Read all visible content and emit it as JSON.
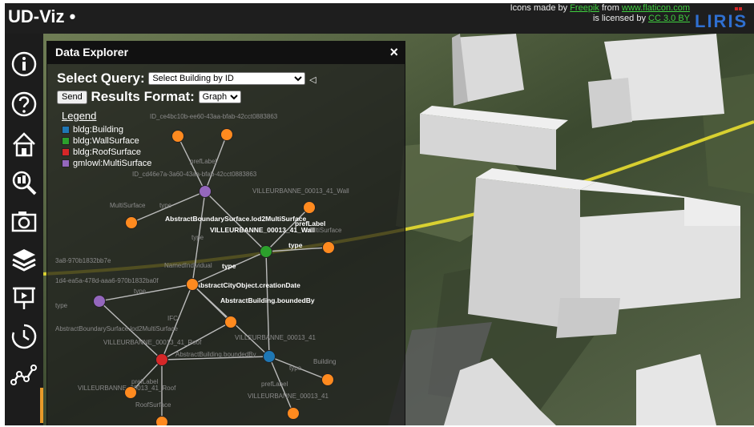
{
  "app": {
    "title": "UD-Viz •"
  },
  "credits": {
    "line1_prefix": "Icons made by ",
    "line1_author": "Freepik",
    "line1_mid": " from ",
    "line1_site": "www.flaticon.com",
    "line2_prefix": "is licensed by ",
    "line2_license": "CC 3.0 BY",
    "logo_text": "LIRIS"
  },
  "sidebar": {
    "items": [
      {
        "name": "about-icon",
        "symbol": "i"
      },
      {
        "name": "help-icon",
        "symbol": "?"
      },
      {
        "name": "home-icon"
      },
      {
        "name": "city-search-icon"
      },
      {
        "name": "camera-icon"
      },
      {
        "name": "layers-icon"
      },
      {
        "name": "presentation-icon"
      },
      {
        "name": "time-icon"
      },
      {
        "name": "graph-icon"
      }
    ]
  },
  "explorer": {
    "title": "Data Explorer",
    "close": "×",
    "query_label": "Select Query:",
    "query_value": "Select Building by ID",
    "query_arrow": "◁",
    "send_label": "Send",
    "format_label": "Results Format:",
    "format_value": "Graph",
    "legend": {
      "title": "Legend",
      "items": [
        {
          "label": "bldg:Building",
          "color": "#1f77b4"
        },
        {
          "label": "bldg:WallSurface",
          "color": "#2ca02c"
        },
        {
          "label": "bldg:RoofSurface",
          "color": "#d62728"
        },
        {
          "label": "gmlowl:MultiSurface",
          "color": "#9467bd"
        }
      ]
    }
  },
  "graph": {
    "bold_labels": [
      "AbstractBoundarySurface.lod2MultiSurface",
      "prefLabel",
      "VILLEURBANNE_00013_41_Wall",
      "type",
      "type",
      "AbstractCityObject.creationDate",
      "AbstractBuilding.boundedBy"
    ],
    "faint_labels": [
      "ID_ce4bc10b-ee60-43aa-bfab-42cct0883863",
      "prefLabel",
      "ID_cd46e7a-3a60-43aa-bfab-42cct0883863",
      "VILLEURBANNE_00013_41_Wall",
      "MultiSurface",
      "type",
      "MultiSurface",
      "type",
      "NamedIndividual",
      "3a8-970b1832bb7e",
      "1d4-ea5a-478d-aaa6-970b1832ba0f",
      "type",
      "type",
      "IFC",
      "AbstractBoundarySurface.lod2MultiSurface",
      "VILLEURBANNE_00013_41_Roof",
      "AbstractBuilding.boundedBy",
      "VILLEURBANNE_00013_41",
      "type",
      "Building",
      "prefLabel",
      "prefLabel",
      "VILLEURBANNE_00013_41_Roof",
      "RoofSurface",
      "VILLEURBANNE_00013_41"
    ],
    "colors": {
      "node": "#ff8a1f",
      "building": "#1f77b4",
      "wall": "#2ca02c",
      "roof": "#d62728",
      "multisurface": "#9467bd",
      "edge": "#bbbbbb"
    }
  }
}
